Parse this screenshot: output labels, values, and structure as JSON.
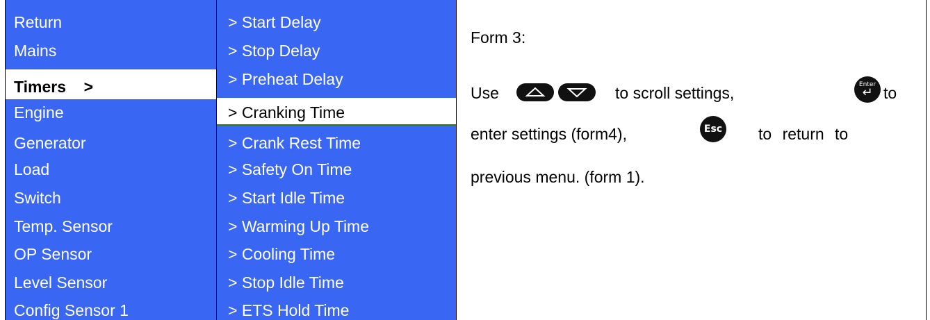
{
  "menu_level1": {
    "items": [
      {
        "label": "Return"
      },
      {
        "label": "Mains"
      },
      {
        "label": "Timers    >",
        "selected": true
      },
      {
        "label": "Engine"
      },
      {
        "label": "Generator"
      },
      {
        "label": "Load"
      },
      {
        "label": "Switch"
      },
      {
        "label": "Temp. Sensor"
      },
      {
        "label": "OP Sensor"
      },
      {
        "label": "Level Sensor"
      },
      {
        "label": "Config Sensor 1"
      }
    ]
  },
  "menu_level2": {
    "items": [
      {
        "label": "> Start Delay"
      },
      {
        "label": "> Stop Delay"
      },
      {
        "label": "> Preheat Delay"
      },
      {
        "label": "> Cranking Time",
        "selected": true
      },
      {
        "label": "> Crank Rest Time"
      },
      {
        "label": "> Safety On Time"
      },
      {
        "label": "> Start Idle Time"
      },
      {
        "label": "> Warming Up Time"
      },
      {
        "label": "> Cooling Time"
      },
      {
        "label": "> Stop Idle Time"
      },
      {
        "label": "> ETS Hold Time"
      }
    ]
  },
  "help": {
    "title": "Form 3:",
    "line1_use": "Use",
    "line1_scroll": "to scroll settings,",
    "line1_to": "to",
    "line2_enter": "enter settings (form4),",
    "line2_return": "to return to",
    "line3": "previous menu. (form 1).",
    "enter_button_label": "Enter",
    "esc_button_label": "Esc"
  },
  "colors": {
    "menu_background": "#3a66f4",
    "menu_text": "#ffffff",
    "selected_background": "#ffffff"
  },
  "icons": [
    "up-arrow-button-icon",
    "down-arrow-button-icon",
    "enter-key-icon",
    "esc-key-icon"
  ]
}
